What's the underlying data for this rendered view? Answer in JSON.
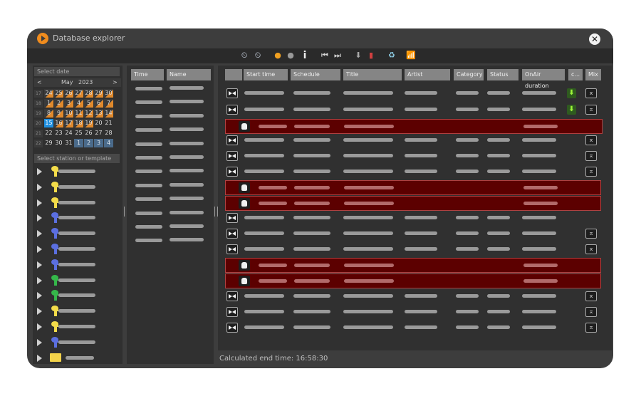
{
  "window": {
    "title": "Database explorer"
  },
  "left_panel": {
    "date_header": "Select  date",
    "calendar": {
      "prev": "<",
      "next": ">",
      "month": "May",
      "year": "2023",
      "weeks": [
        {
          "week": "17",
          "days": [
            "24",
            "25",
            "26",
            "27",
            "28",
            "29",
            "30"
          ],
          "style": "m"
        },
        {
          "week": "18",
          "days": [
            "1",
            "2",
            "3",
            "4",
            "5",
            "6",
            "7"
          ],
          "style": "m"
        },
        {
          "week": "19",
          "days": [
            "8",
            "9",
            "10",
            "11",
            "12",
            "13",
            "14"
          ],
          "style": "m"
        },
        {
          "week": "20",
          "days": [
            "15",
            "16",
            "17",
            "18",
            "19",
            "20",
            "21"
          ],
          "style": "mix"
        },
        {
          "week": "21",
          "days": [
            "22",
            "23",
            "24",
            "25",
            "26",
            "27",
            "28"
          ],
          "style": "plain"
        },
        {
          "week": "22",
          "days": [
            "29",
            "30",
            "31",
            "1",
            "2",
            "3",
            "4"
          ],
          "style": "end"
        }
      ],
      "selected_day": "15"
    },
    "station_header": "Select  station or template",
    "stations": [
      {
        "icon": "yellow-station-icon",
        "color": "#f3dc4a"
      },
      {
        "icon": "yellow-station-icon",
        "color": "#f3dc4a"
      },
      {
        "icon": "yellow-station-icon",
        "color": "#f3dc4a"
      },
      {
        "icon": "blue-station-icon",
        "color": "#5b6fe0"
      },
      {
        "icon": "blue-station-icon",
        "color": "#5b6fe0"
      },
      {
        "icon": "blue-station-icon",
        "color": "#5b6fe0"
      },
      {
        "icon": "blue-station-icon",
        "color": "#5b6fe0"
      },
      {
        "icon": "green-station-icon",
        "color": "#35b84a"
      },
      {
        "icon": "green-station-icon",
        "color": "#35b84a"
      },
      {
        "icon": "yellow-station-icon",
        "color": "#f3dc4a"
      },
      {
        "icon": "yellow-station-icon",
        "color": "#f3dc4a"
      },
      {
        "icon": "blue-station-icon",
        "color": "#5b6fe0"
      },
      {
        "icon": "folder-icon",
        "color": "#f3d34a"
      }
    ]
  },
  "middle_panel": {
    "columns": [
      "Time",
      "Name"
    ]
  },
  "right_panel": {
    "columns": [
      "",
      "Start time",
      "Schedule",
      "Title",
      "Artist",
      "Category",
      "Status",
      "OnAir duration",
      "c...",
      "Mix"
    ],
    "rows": [
      {
        "type": "normal",
        "cue": true,
        "mix": true
      },
      {
        "type": "normal",
        "cue": true,
        "mix": true
      },
      {
        "type": "highlight"
      },
      {
        "type": "normal",
        "cue": false,
        "mix": true
      },
      {
        "type": "normal",
        "cue": false,
        "mix": true
      },
      {
        "type": "normal",
        "cue": false,
        "mix": true
      },
      {
        "type": "highlight"
      },
      {
        "type": "highlight"
      },
      {
        "type": "normal",
        "cue": false,
        "mix": false
      },
      {
        "type": "normal",
        "cue": false,
        "mix": true
      },
      {
        "type": "normal",
        "cue": false,
        "mix": true
      },
      {
        "type": "highlight"
      },
      {
        "type": "highlight"
      },
      {
        "type": "normal",
        "cue": false,
        "mix": true
      },
      {
        "type": "normal",
        "cue": false,
        "mix": true
      },
      {
        "type": "normal",
        "cue": false,
        "mix": true
      }
    ]
  },
  "toolbar": {
    "icons": [
      "add-clock-icon",
      "edit-clock-icon",
      "orange-circle-icon",
      "grey-circle-icon",
      "info-icon",
      "skip-start-icon",
      "skip-end-icon",
      "arrow-down-icon",
      "level-meter-icon",
      "recycle-bin-icon",
      "network-icon"
    ],
    "info_glyph": "i"
  },
  "status_bar": {
    "text": "Calculated end time: 16:58:30"
  },
  "colors": {
    "highlight_row": "#5c0000",
    "accent": "#f08c1e",
    "selected_day": "#1f8fe0"
  }
}
